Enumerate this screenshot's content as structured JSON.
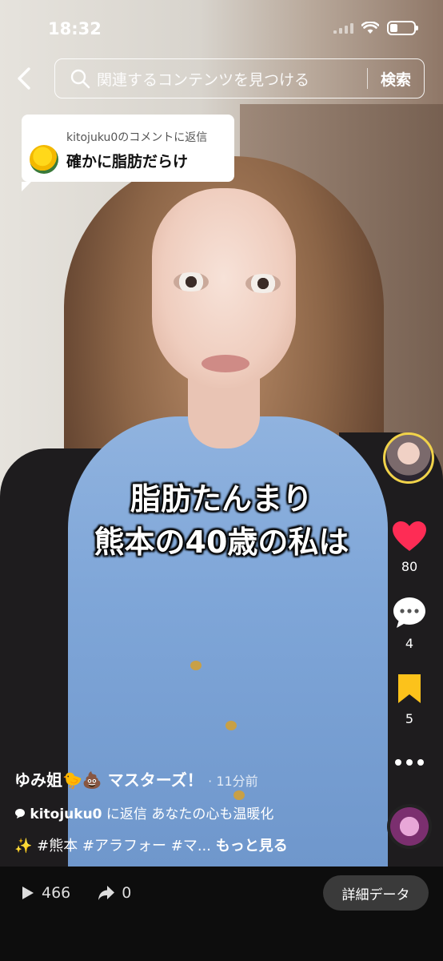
{
  "status_bar": {
    "time": "18:32"
  },
  "search": {
    "placeholder": "関連するコンテンツを見つける",
    "button": "検索"
  },
  "reply_card": {
    "header": "kitojuku0のコメントに返信",
    "text": "確かに脂肪だらけ"
  },
  "overlay": {
    "line1": "脂肪たんまり",
    "line2": "熊本の40歳の私は"
  },
  "actions": {
    "likes": "80",
    "comments": "4",
    "saves": "5"
  },
  "meta": {
    "author": "ゆみ姐🐤💩 マスターズ！",
    "time_ago": "· 11分前",
    "reply_user": "kitojuku0",
    "reply_label": "に返信",
    "reply_text": "あなたの心も温暖化",
    "tags": "✨ #熊本 #アラフォー #マ...",
    "more": "もっと見る"
  },
  "stats": {
    "plays": "466",
    "shares": "0"
  },
  "details_button": "詳細データ"
}
